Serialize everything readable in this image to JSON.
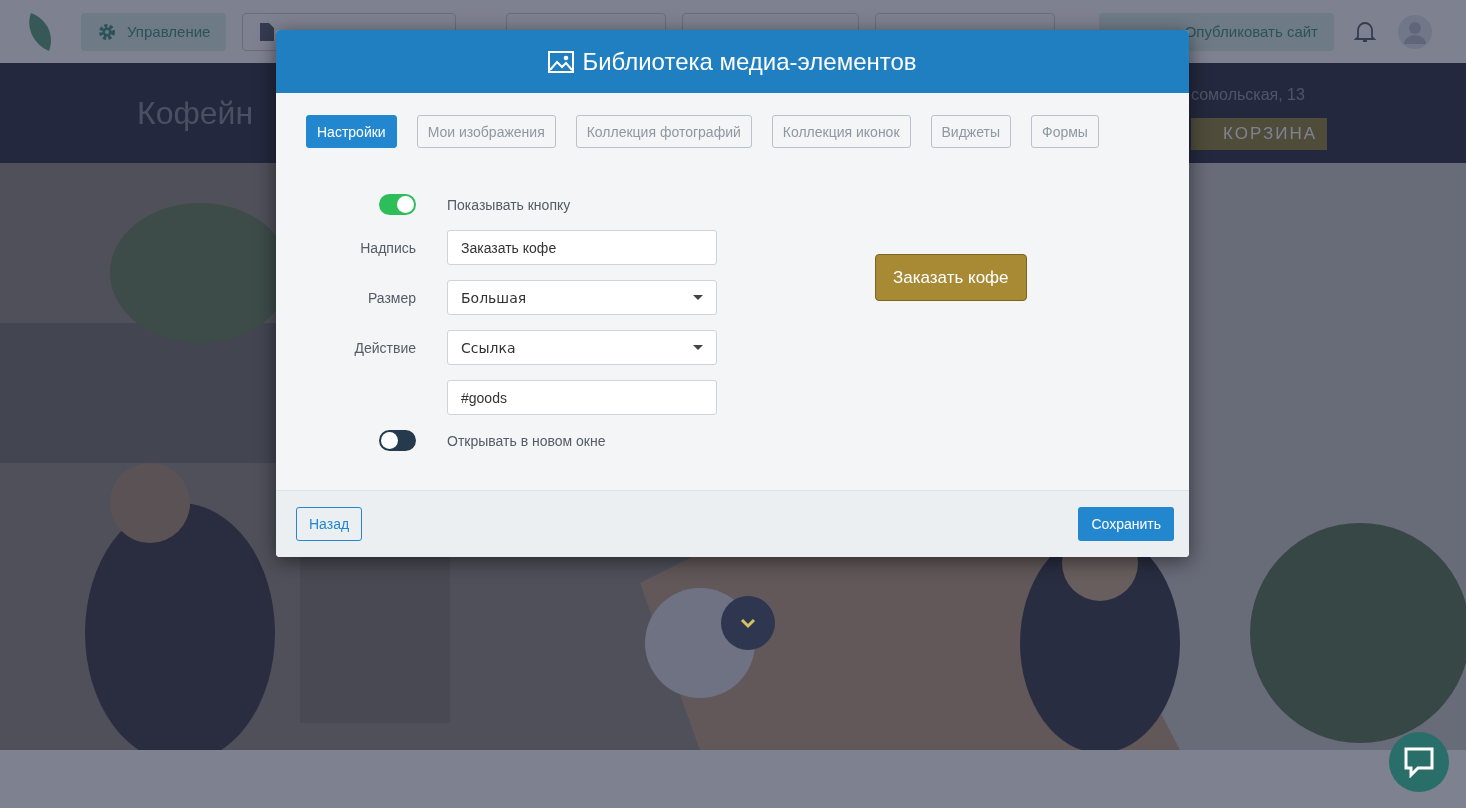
{
  "topbar": {
    "manage_button": "Управление",
    "publish_button": "Опубликовать сайт"
  },
  "hero": {
    "title": "Кофейн",
    "address": "сомольская, 13",
    "cart_button": "КОРЗИНА"
  },
  "modal": {
    "title": "Библиотека медиа-элементов",
    "tabs": [
      {
        "label": "Настройки",
        "selected": true
      },
      {
        "label": "Мои изображения",
        "selected": false
      },
      {
        "label": "Коллекция фотографий",
        "selected": false
      },
      {
        "label": "Коллекция иконок",
        "selected": false
      },
      {
        "label": "Виджеты",
        "selected": false
      },
      {
        "label": "Формы",
        "selected": false
      }
    ],
    "fields": [
      {
        "kind": "toggle",
        "label": "Показывать кнопку",
        "on": true
      },
      {
        "kind": "text",
        "label": "Надпись",
        "value": "Заказать кофе"
      },
      {
        "kind": "select",
        "label": "Размер",
        "value": "Большая"
      },
      {
        "kind": "select",
        "label": "Действие",
        "value": "Ссылка"
      },
      {
        "kind": "text",
        "value": "#goods"
      },
      {
        "kind": "toggle",
        "label": "Открывать в новом окне",
        "on": false
      }
    ],
    "preview_button": "Заказать кофе",
    "back_button": "Назад",
    "save_button": "Сохранить"
  }
}
